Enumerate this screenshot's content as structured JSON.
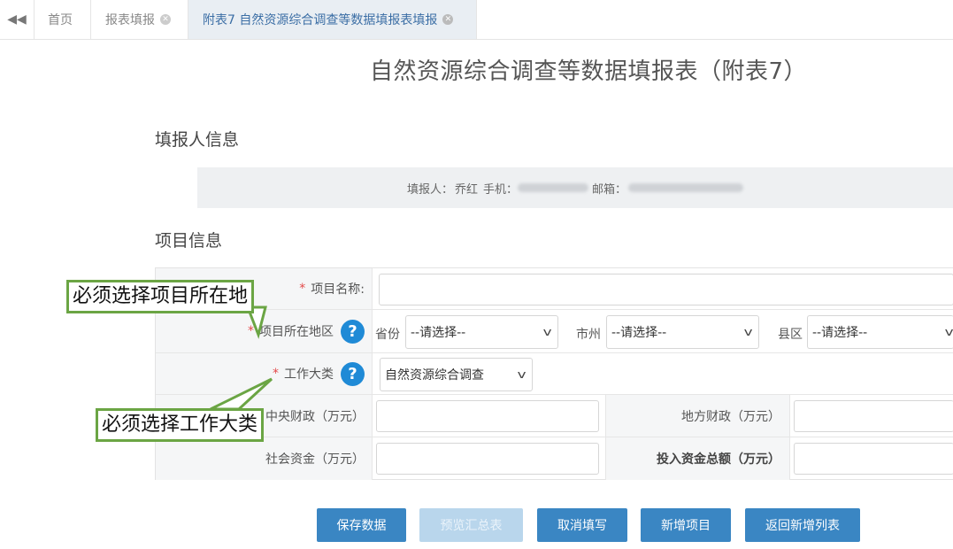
{
  "tabs": [
    {
      "label": "首页"
    },
    {
      "label": "报表填报"
    },
    {
      "label": "附表7 自然资源综合调查等数据填报表填报"
    }
  ],
  "page_title": "自然资源综合调查等数据填报表（附表7）",
  "filler": {
    "section_title": "填报人信息",
    "name_label": "填报人：",
    "name": "乔红",
    "phone_label": "手机：",
    "email_label": "邮箱："
  },
  "project": {
    "section_title": "项目信息",
    "name_label": "项目名称:",
    "region_label": "项目所在地区",
    "province_label": "省份",
    "province_value": "--请选择--",
    "city_label": "市州",
    "city_value": "--请选择--",
    "county_label": "县区",
    "county_value": "--请选择--",
    "category_label": "工作大类",
    "category_value": "自然资源综合调查",
    "central_finance_label": "中央财政（万元）",
    "local_finance_label": "地方财政（万元）",
    "social_fund_label": "社会资金（万元）",
    "total_fund_label": "投入资金总额（万元）"
  },
  "buttons": {
    "save": "保存数据",
    "preview": "预览汇总表",
    "cancel": "取消填写",
    "add": "新增项目",
    "back": "返回新增列表"
  },
  "callouts": {
    "region": "必须选择项目所在地",
    "category": "必须选择工作大类"
  },
  "colors": {
    "accent": "#3a86c3",
    "required": "#e34a4a",
    "callout_border": "#6ba544",
    "help_icon": "#1f8ad6"
  }
}
